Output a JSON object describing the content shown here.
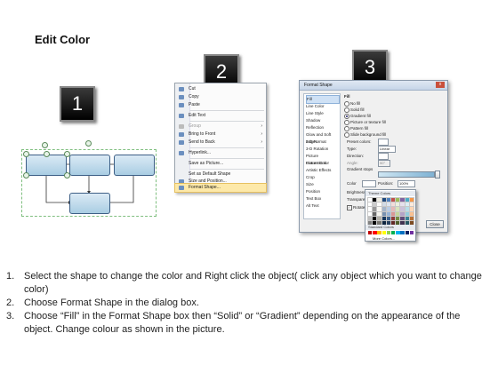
{
  "title": "Edit Color",
  "badges": [
    "1",
    "2",
    "3"
  ],
  "context_menu": {
    "items": [
      {
        "label": "Cut",
        "disabled": false,
        "submenu": false
      },
      {
        "label": "Copy",
        "disabled": false,
        "submenu": false
      },
      {
        "label": "Paste",
        "disabled": false,
        "submenu": false
      },
      {
        "label": "Edit Text",
        "disabled": false,
        "submenu": false
      },
      {
        "label": "Group",
        "disabled": true,
        "submenu": true
      },
      {
        "label": "Bring to Front",
        "disabled": false,
        "submenu": true
      },
      {
        "label": "Send to Back",
        "disabled": false,
        "submenu": true
      },
      {
        "label": "Hyperlink...",
        "disabled": false,
        "submenu": false
      },
      {
        "label": "Save as Picture...",
        "disabled": false,
        "submenu": false
      },
      {
        "label": "Set as Default Shape",
        "disabled": false,
        "submenu": false
      },
      {
        "label": "Size and Position...",
        "disabled": false,
        "submenu": false
      },
      {
        "label": "Format Shape...",
        "disabled": false,
        "submenu": false,
        "highlighted": true
      }
    ]
  },
  "format_dialog": {
    "title": "Format Shape",
    "close": "x",
    "categories": [
      "Fill",
      "Line Color",
      "Line Style",
      "Shadow",
      "Reflection",
      "Glow and Soft Edges",
      "3-D Format",
      "3-D Rotation",
      "Picture Corrections",
      "Picture Color",
      "Artistic Effects",
      "Crop",
      "Size",
      "Position",
      "Text Box",
      "Alt Text"
    ],
    "section_title": "Fill",
    "fill_options": [
      "No fill",
      "Solid fill",
      "Gradient fill",
      "Picture or texture fill",
      "Pattern fill",
      "Slide background fill"
    ],
    "selected_fill": "Gradient fill",
    "gradient_labels": [
      "Preset colors:",
      "Type:",
      "Direction:",
      "Angle:",
      "Gradient stops"
    ],
    "type_value": "Linear",
    "angle_value": "90°",
    "color_label": "Color",
    "position_label": "Position:",
    "position_value": "100%",
    "brightness_label": "Brightness:",
    "transparency_label": "Transparency:",
    "rotate_label": "Rotate with shape",
    "close_button": "Close"
  },
  "palette": {
    "theme_header": "Theme Colors",
    "standard_header": "Standard Colors",
    "more": "More Colors...",
    "theme_colors": [
      "#ffffff",
      "#000000",
      "#eeece1",
      "#1f497d",
      "#4f81bd",
      "#c0504d",
      "#9bbb59",
      "#8064a2",
      "#4bacc6",
      "#f79646"
    ],
    "standard_colors": [
      "#c00000",
      "#ff0000",
      "#ffc000",
      "#ffff00",
      "#92d050",
      "#00b050",
      "#00b0f0",
      "#0070c0",
      "#002060",
      "#7030a0"
    ]
  },
  "steps": [
    {
      "num": "1.",
      "text": "Select the shape to change the color and Right click the object( click any object which you want to change color)"
    },
    {
      "num": "2.",
      "text": "Choose Format Shape in the dialog box."
    },
    {
      "num": "3.",
      "text": "Choose “Fill” in the Format Shape box then “Solid” or “Gradient” depending on the appearance of the object. Change colour as shown in the picture."
    }
  ]
}
